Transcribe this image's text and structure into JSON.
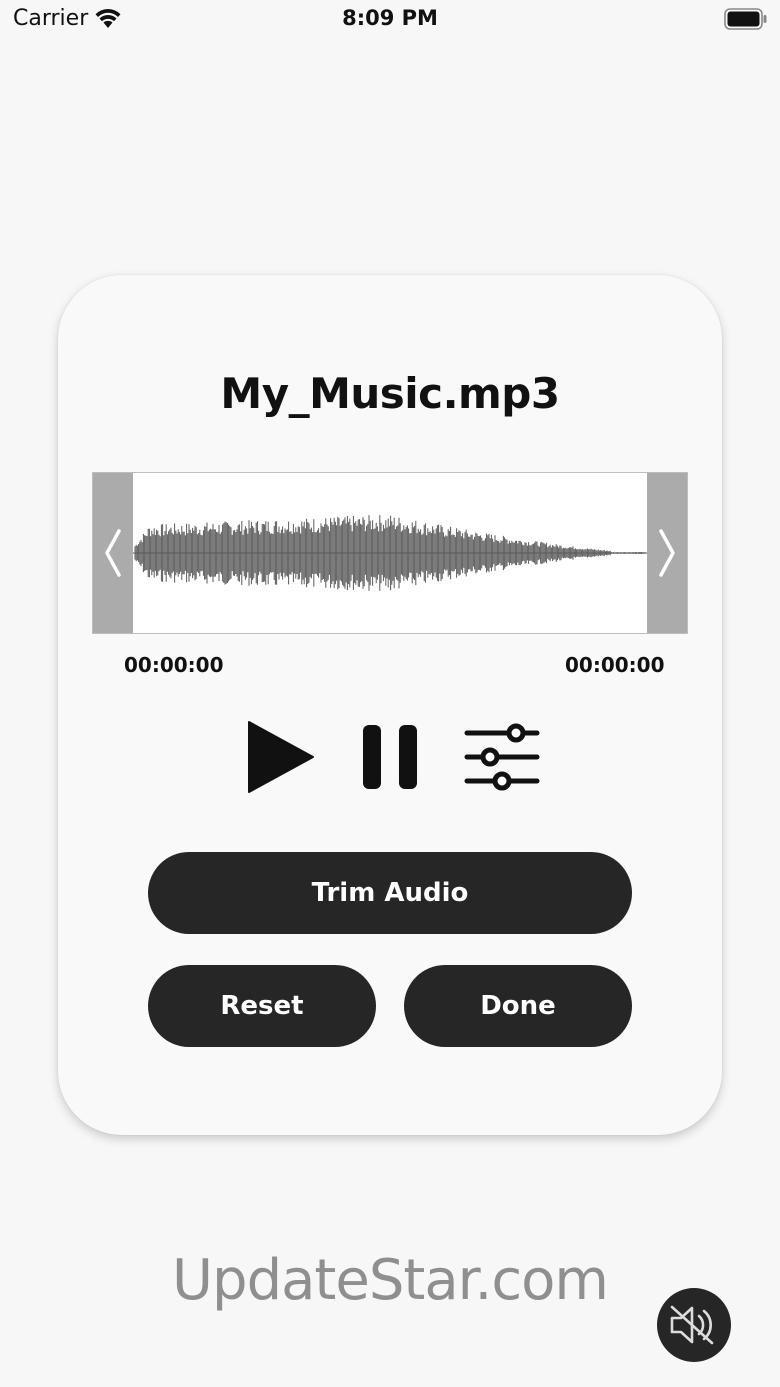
{
  "status_bar": {
    "carrier": "Carrier",
    "time": "8:09 PM",
    "wifi_icon": "wifi-icon",
    "battery_icon": "battery-icon"
  },
  "player": {
    "file_name": "My_Music.mp3",
    "start_time": "00:00:00",
    "end_time": "00:00:00",
    "controls": {
      "play_icon": "play-icon",
      "pause_icon": "pause-icon",
      "settings_icon": "sliders-icon"
    }
  },
  "buttons": {
    "trim_label": "Trim Audio",
    "reset_label": "Reset",
    "done_label": "Done"
  },
  "watermark": "UpdateStar.com",
  "mute_icon": "speaker-muted-icon",
  "colors": {
    "button_bg": "#262626",
    "handle_gray": "#ababab",
    "waveform": "#5a5a5a"
  }
}
